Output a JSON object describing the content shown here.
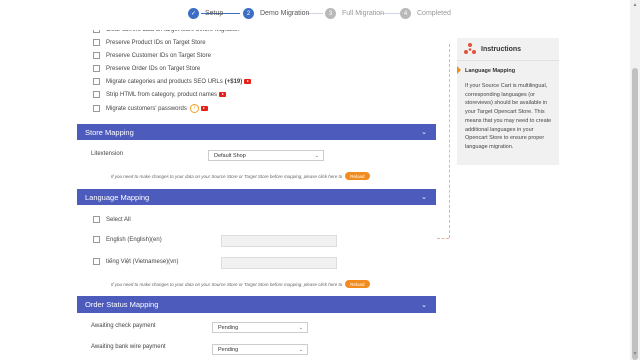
{
  "stepper": {
    "steps": [
      {
        "label": "Setup",
        "num": "✓",
        "state": "done"
      },
      {
        "label": "Demo Migration",
        "num": "2",
        "state": "active"
      },
      {
        "label": "Full Migration",
        "num": "3",
        "state": "inactive"
      },
      {
        "label": "Completed",
        "num": "4",
        "state": "inactive"
      }
    ]
  },
  "options": {
    "items": [
      "Clear current data on target store before Migration",
      "Preserve Product IDs on Target Store",
      "Preserve Customer IDs on Target Store",
      "Preserve Order IDs on Target Store",
      "Migrate categories and products SEO URLs",
      "Strip HTML from category, product names",
      "Migrate customers' passwords"
    ],
    "seo_price": "(+$19)",
    "info_glyph": "i"
  },
  "store_mapping": {
    "title": "Store Mapping",
    "label": "Litextension",
    "selected": "Default Shop",
    "hint": "If you need to make changes to your data on your Source Store or Target Store before mapping, please click here to",
    "reload": "Reload"
  },
  "language_mapping": {
    "title": "Language Mapping",
    "select_all": "Select All",
    "languages": [
      "English (English)(en)",
      "tiếng Việt (Vietnamese)(vn)"
    ],
    "hint": "If you need to make changes to your data on your Source Store or Target Store before mapping, please click here to",
    "reload": "Reload"
  },
  "order_status_mapping": {
    "title": "Order Status Mapping",
    "rows": [
      {
        "label": "Awaiting check payment",
        "selected": "Pending"
      },
      {
        "label": "Awaiting bank wire payment",
        "selected": "Pending"
      }
    ]
  },
  "instructions": {
    "title": "Instructions",
    "subtitle": "Language Mapping",
    "text": "If your Source Cart is multilingual, corresponding languages (or storeviews) should be available in your Target Opencart Store. This means that you may need to create additional languages in your Opencart Store to ensure proper language migration."
  },
  "colors": {
    "accent_blue": "#4d5bbd",
    "reload_orange": "#f28c1e",
    "active_step": "#3c6fc4",
    "inactive_step": "#b9b9b9"
  }
}
